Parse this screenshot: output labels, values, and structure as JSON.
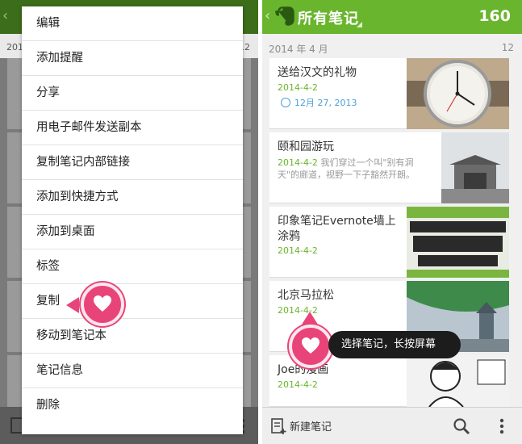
{
  "right": {
    "title": "所有笔记",
    "count": "160",
    "section_label": "2014 年 4 月",
    "section_count": "12",
    "notes": [
      {
        "title": "送给汉文的礼物",
        "date": "2014-4-2",
        "reminder": "12月 27, 2013"
      },
      {
        "title": "颐和园游玩",
        "date": "2014-4-2",
        "snippet": "我们穿过一个叫\"别有洞天\"的廊道，视野一下子豁然开朗。"
      },
      {
        "title": "印象笔记Evernote墙上涂鸦",
        "date": "2014-4-2"
      },
      {
        "title": "北京马拉松",
        "date": "2014-4-2"
      },
      {
        "title": "Joe的漫画",
        "date": "2014-4-2"
      }
    ],
    "new_note_label": "新建笔记",
    "tooltip": "选择笔记，长按屏幕"
  },
  "menu": {
    "items": [
      "编辑",
      "添加提醒",
      "分享",
      "用电子邮件发送副本",
      "复制笔记内部链接",
      "添加到快捷方式",
      "添加到桌面",
      "标签",
      "复制",
      "移动到笔记本",
      "笔记信息",
      "删除"
    ]
  },
  "left_bg": {
    "section_label": "201",
    "section_count": "12"
  },
  "colors": {
    "brand_green": "#6ab52e",
    "highlight_pink": "#e8447a",
    "reminder_blue": "#4aa0d8"
  },
  "icons": [
    "elephant-icon",
    "back-arrow-icon",
    "alarm-icon",
    "new-note-icon",
    "search-icon",
    "overflow-icon",
    "heart-icon"
  ]
}
